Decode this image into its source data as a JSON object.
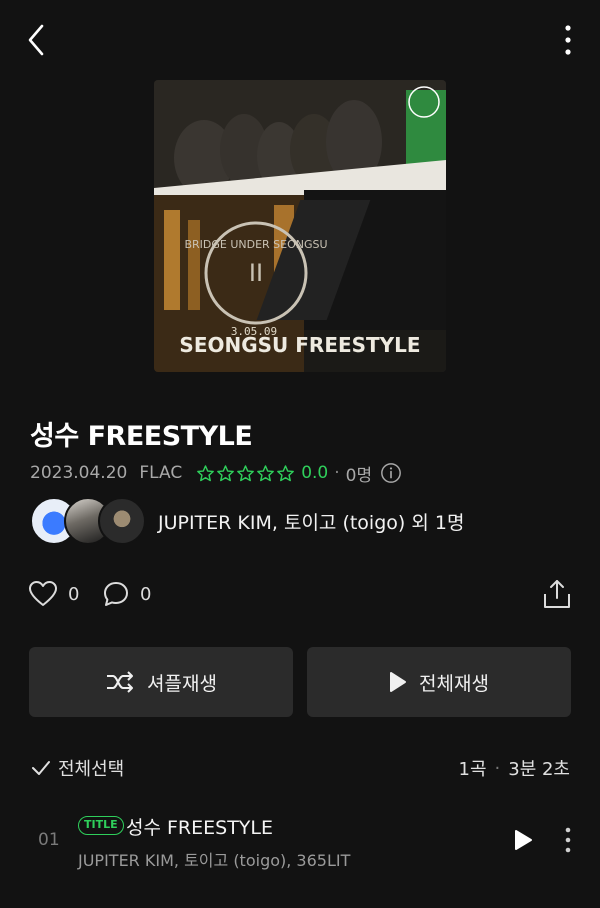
{
  "album": {
    "title": "성수 FREESTYLE",
    "release_date": "2023.04.20",
    "format": "FLAC",
    "rating": "0.0",
    "rating_count": "0명",
    "stars_total": 5,
    "artists_text": "JUPITER KIM, 토이고 (toigo) 외 1명"
  },
  "actions": {
    "likes": "0",
    "comments": "0"
  },
  "buttons": {
    "shuffle_label": "셔플재생",
    "play_all_label": "전체재생"
  },
  "tracklist": {
    "select_all_label": "전체선택",
    "track_count": "1곡",
    "total_duration": "3분 2초",
    "tracks": [
      {
        "number": "01",
        "badge": "TITLE",
        "title": "성수 FREESTYLE",
        "artists": "JUPITER KIM, 토이고 (toigo), 365LIT"
      }
    ]
  },
  "cover_art": {
    "text_circle": "BRIDGE UNDER SEONGSU",
    "text_date": "3.05.09",
    "text_logo": "SEONGSU FREESTYLE"
  },
  "icons": {
    "back": "chevron-left-icon",
    "more": "vertical-dots-icon",
    "star": "star-outline-icon",
    "info": "info-circle-icon",
    "like": "heart-outline-icon",
    "comment": "speech-bubble-icon",
    "share": "share-upload-icon",
    "shuffle": "shuffle-icon",
    "play": "play-icon",
    "check": "checkmark-icon"
  },
  "colors": {
    "background": "#121212",
    "accent_green": "#2fcf5b",
    "button_bg": "#2b2b2b",
    "muted_text": "#a8a8a8"
  }
}
